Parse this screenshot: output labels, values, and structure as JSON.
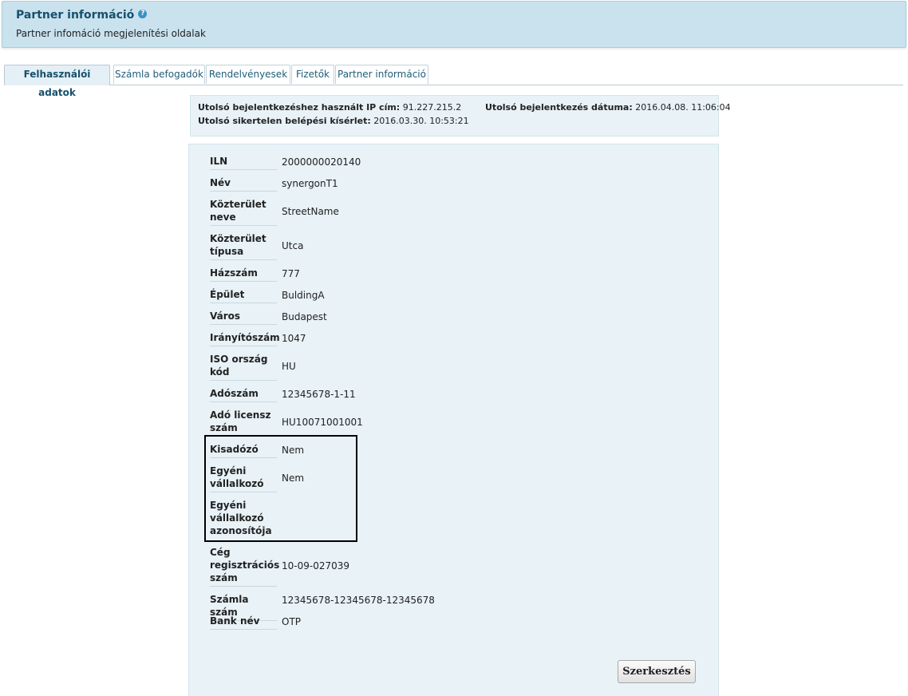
{
  "header": {
    "title": "Partner információ",
    "help_glyph": "?",
    "subtitle": "Partner infomáció megjelenítési oldalak"
  },
  "tabs": [
    {
      "label": "Felhasználói adatok",
      "active": true
    },
    {
      "label": "Számla befogadók",
      "active": false
    },
    {
      "label": "Rendelvényesek",
      "active": false
    },
    {
      "label": "Fizetők",
      "active": false
    },
    {
      "label": "Partner információ",
      "active": false
    }
  ],
  "login_info": {
    "last_ip_label": "Utolsó bejelentkezéshez használt IP cím:",
    "last_ip_value": "91.227.215.2",
    "last_date_label": "Utolsó bejelentkezés dátuma:",
    "last_date_value": "2016.04.08. 11:06:04",
    "failed_label": "Utolsó sikertelen belépési kísérlet:",
    "failed_value": "2016.03.30. 10:53:21"
  },
  "fields": [
    {
      "label": "ILN",
      "value": "2000000020140"
    },
    {
      "label": "Név",
      "value": "synergonT1"
    },
    {
      "label": "Közterület neve",
      "value": "StreetName"
    },
    {
      "label": "Közterület típusa",
      "value": "Utca"
    },
    {
      "label": "Házszám",
      "value": "777"
    },
    {
      "label": "Épület",
      "value": "BuldingA"
    },
    {
      "label": "Város",
      "value": "Budapest"
    },
    {
      "label": "Irányítószám",
      "value": "1047"
    },
    {
      "label": "ISO ország kód",
      "value": "HU"
    },
    {
      "label": "Adószám",
      "value": "12345678-1-11"
    },
    {
      "label": "Adó licensz szám",
      "value": "HU10071001001"
    },
    {
      "label": "Kisadózó",
      "value": "Nem"
    },
    {
      "label": "Egyéni vállalkozó",
      "value": "Nem"
    },
    {
      "label": "Egyéni vállalkozó azonosítója",
      "value": ""
    },
    {
      "label": "Cég regisztrációs szám",
      "value": "10-09-027039"
    },
    {
      "label": "Számla szám",
      "value": "12345678-12345678-12345678"
    },
    {
      "label": "Bank név",
      "value": "OTP"
    }
  ],
  "actions": {
    "edit_label": "Szerkesztés"
  }
}
